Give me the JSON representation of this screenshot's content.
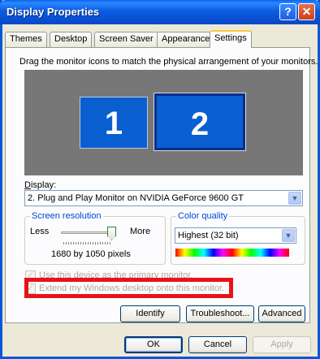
{
  "window": {
    "title": "Display Properties",
    "help_glyph": "?",
    "close_glyph": "✕"
  },
  "tabs": [
    {
      "label": "Themes"
    },
    {
      "label": "Desktop"
    },
    {
      "label": "Screen Saver"
    },
    {
      "label": "Appearance"
    },
    {
      "label": "Settings",
      "active": true
    }
  ],
  "settings": {
    "instruction": "Drag the monitor icons to match the physical arrangement of your monitors.",
    "monitors": [
      {
        "number": "1"
      },
      {
        "number": "2",
        "selected": true
      }
    ],
    "display_label": "Display:",
    "display_value": "2. Plug and Play Monitor on NVIDIA GeForce 9600 GT",
    "resolution": {
      "group_title": "Screen resolution",
      "less_label": "Less",
      "more_label": "More",
      "value": "1680 by 1050 pixels",
      "slider_level": 1.0
    },
    "color_quality": {
      "group_title": "Color quality",
      "value": "Highest (32 bit)"
    },
    "primary_checkbox": {
      "label": "Use this device as the primary monitor.",
      "checked": true,
      "disabled": true
    },
    "extend_checkbox": {
      "label": "Extend my Windows desktop onto this monitor.",
      "checked": true,
      "disabled": true
    },
    "identify_button": "Identify",
    "troubleshoot_button": "Troubleshoot...",
    "advanced_button": "Advanced"
  },
  "footer": {
    "ok": "OK",
    "cancel": "Cancel",
    "apply": "Apply"
  },
  "colors": {
    "titlebar": "#0a5fd0",
    "highlight_box": "#e8131a",
    "monitor": "#0a5fd0"
  },
  "icons": [
    "help-icon",
    "close-icon",
    "chevron-down-icon",
    "checkbox-icon"
  ]
}
